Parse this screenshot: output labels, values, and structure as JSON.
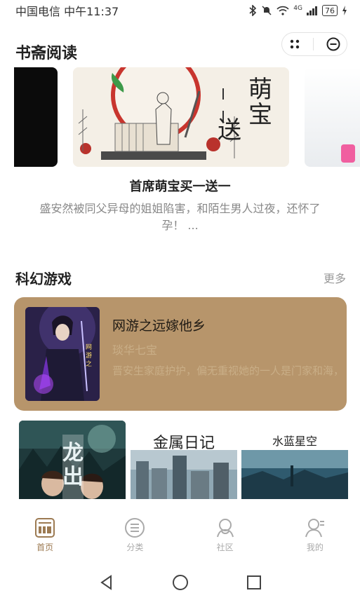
{
  "status": {
    "carrier": "中国电信 中午11:37",
    "network": "4G",
    "battery": "76"
  },
  "header": {
    "title": "书斋阅读"
  },
  "banner": {
    "title": "首席萌宝买一送一",
    "description": "盛安然被同父异母的姐姐陷害，和陌生男人过夜，还怀了孕！ ...",
    "cover_text_a": "萌宝",
    "cover_text_b": "送"
  },
  "section": {
    "title": "科幻游戏",
    "more_label": "更多"
  },
  "featured": {
    "name": "网游之远嫁他乡",
    "author": "琰华七宝",
    "description": "晋安生家庭护护，偏无重视她的一人是门家和海，却刷网游龙王..."
  },
  "covers": [
    {
      "title": "龙出"
    },
    {
      "title": "金属日记"
    },
    {
      "title": "水蓝星空"
    }
  ],
  "tabs": [
    {
      "label": "首页",
      "icon": "home-book-icon",
      "active": true
    },
    {
      "label": "分类",
      "icon": "category-list-icon",
      "active": false
    },
    {
      "label": "社区",
      "icon": "community-icon",
      "active": false
    },
    {
      "label": "我的",
      "icon": "user-profile-icon",
      "active": false
    }
  ],
  "colors": {
    "accent": "#9c7a52",
    "featured_bg": "#b7956b"
  }
}
